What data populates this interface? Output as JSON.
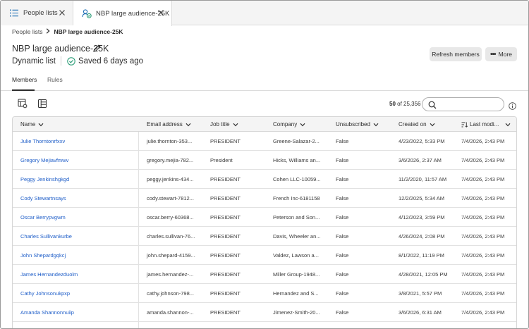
{
  "tabs": [
    {
      "label": "People lists",
      "icon": "list-icon"
    },
    {
      "label": "NBP large audience-25K",
      "icon": "people-list-icon"
    }
  ],
  "breadcrumb": {
    "parent": "People lists",
    "current": "NBP large audience-25K"
  },
  "page": {
    "title": "NBP large audience-25K",
    "list_type": "Dynamic list",
    "saved_status": "Saved 6 days ago"
  },
  "actions": {
    "refresh_label": "Refresh members",
    "more_label": "More"
  },
  "subtabs": [
    {
      "label": "Members",
      "active": true
    },
    {
      "label": "Rules",
      "active": false
    }
  ],
  "toolbar": {
    "count_shown": "50",
    "count_of": "of 25,356",
    "search_placeholder": ""
  },
  "table": {
    "columns": [
      "Name",
      "Email address",
      "Job title",
      "Company",
      "Unsubscribed",
      "Created on",
      "Last modi..."
    ],
    "rows": [
      [
        "Julie Thorntonrfxxv",
        "julie.thornton-353...",
        "PRESIDENT",
        "Greene-Salazar-2...",
        "False",
        "4/23/2022, 5:33 PM",
        "7/4/2026, 2:43 PM"
      ],
      [
        "Gregory Mejiavfmwv",
        "gregory.mejia-782...",
        "President",
        "Hicks, Williams an...",
        "False",
        "3/6/2026, 2:37 AM",
        "7/4/2026, 2:43 PM"
      ],
      [
        "Peggy Jenkinshgkgd",
        "peggy.jenkins-434...",
        "PRESIDENT",
        "Cohen LLC-10059...",
        "False",
        "11/2/2020, 11:57 AM",
        "7/4/2026, 2:43 PM"
      ],
      [
        "Cody Stewartnsays",
        "cody.stewart-7812...",
        "PRESIDENT",
        "French Inc-6181158",
        "False",
        "12/2/2025, 5:34 AM",
        "7/4/2026, 2:43 PM"
      ],
      [
        "Oscar Berrypvgwm",
        "oscar.berry-60368...",
        "PRESIDENT",
        "Peterson and Son...",
        "False",
        "4/12/2023, 3:59 PM",
        "7/4/2026, 2:43 PM"
      ],
      [
        "Charles Sullivankurbe",
        "charles.sullivan-76...",
        "PRESIDENT",
        "Davis, Wheeler an...",
        "False",
        "4/26/2024, 2:08 PM",
        "7/4/2026, 2:43 PM"
      ],
      [
        "John Shepardgqkcj",
        "john.shepard-4159...",
        "PRESIDENT",
        "Valdez, Lawson a...",
        "False",
        "8/1/2022, 11:19 PM",
        "7/4/2026, 2:43 PM"
      ],
      [
        "James Hernandezduolm",
        "james.hernandez-...",
        "PRESIDENT",
        "Miller Group-1948...",
        "False",
        "4/28/2021, 12:05 PM",
        "7/4/2026, 2:43 PM"
      ],
      [
        "Cathy Johnsonukpxp",
        "cathy.johnson-798...",
        "PRESIDENT",
        "Hernandez and S...",
        "False",
        "3/8/2021, 5:57 PM",
        "7/4/2026, 2:43 PM"
      ],
      [
        "Amanda Shannonnuiip",
        "amanda.shannon-...",
        "PRESIDENT",
        "Jimenez-Smith-20...",
        "False",
        "3/6/2026, 6:31 AM",
        "7/4/2026, 2:43 PM"
      ]
    ]
  },
  "colors": {
    "link": "#1f5ec8",
    "success": "#2d9d78"
  }
}
